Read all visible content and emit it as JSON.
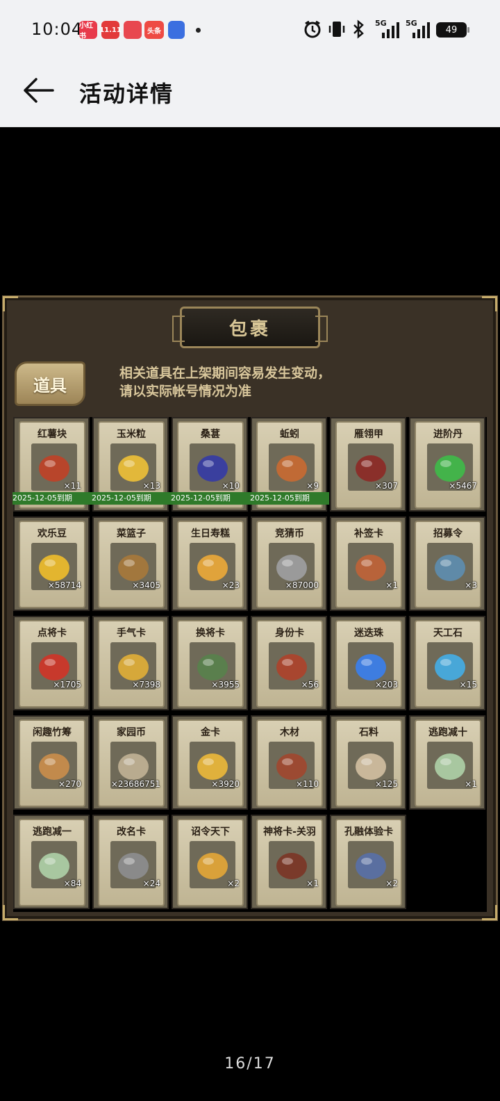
{
  "status_bar": {
    "time": "10:04",
    "notifications": [
      {
        "icon": "xiaohongshu-app-icon",
        "text": "小红书",
        "color": "#e83a4b"
      },
      {
        "icon": "tmall-1111-app-icon",
        "text": "11.11",
        "color": "#e23a3a"
      },
      {
        "icon": "dianping-app-icon",
        "text": "",
        "color": "#e8474f"
      },
      {
        "icon": "toutiao-app-icon",
        "text": "头条",
        "color": "#ee4a43"
      },
      {
        "icon": "browser-app-icon",
        "text": "",
        "color": "#3b6fe0"
      }
    ],
    "signal_1": "5G",
    "signal_2": "5G",
    "battery": "49"
  },
  "app_bar": {
    "title": "活动详情"
  },
  "panel": {
    "title": "包裹",
    "tab": "道具",
    "notice_line1": "相关道具在上架期间容易发生变动，",
    "notice_line2": "请以实际帐号情况为准"
  },
  "items": [
    {
      "name": "红薯块",
      "count": "×11",
      "icon": "sweet-potato-icon",
      "color": "#b8452b",
      "expiry": "2025-12-05到期"
    },
    {
      "name": "玉米粒",
      "count": "×13",
      "icon": "corn-icon",
      "color": "#e2b83a",
      "expiry": "2025-12-05到期"
    },
    {
      "name": "桑葚",
      "count": "×10",
      "icon": "mulberry-icon",
      "color": "#3a3f9e",
      "expiry": "2025-12-05到期"
    },
    {
      "name": "蚯蚓",
      "count": "×9",
      "icon": "earthworm-icon",
      "color": "#c06a35",
      "expiry": "2025-12-05到期"
    },
    {
      "name": "雁翎甲",
      "count": "×307",
      "icon": "armor-icon",
      "color": "#8a2f2a"
    },
    {
      "name": "进阶丹",
      "count": "×5467",
      "icon": "green-pill-icon",
      "color": "#43b34a"
    },
    {
      "name": "欢乐豆",
      "count": "×58714",
      "icon": "gold-beans-icon",
      "color": "#e3b52f"
    },
    {
      "name": "菜篮子",
      "count": "×3405",
      "icon": "vegetable-basket-icon",
      "color": "#a2773d"
    },
    {
      "name": "生日寿糕",
      "count": "×23",
      "icon": "birthday-cake-icon",
      "color": "#e0a33b"
    },
    {
      "name": "竞猜币",
      "count": "×87000",
      "icon": "silver-coin-icon",
      "color": "#9a9a9a"
    },
    {
      "name": "补签卡",
      "count": "×1",
      "icon": "makeup-card-icon",
      "color": "#b8633a"
    },
    {
      "name": "招募令",
      "count": "×3",
      "icon": "recruit-token-icon",
      "color": "#5f8aa8"
    },
    {
      "name": "点将卡",
      "count": "×1705",
      "icon": "general-card-icon",
      "color": "#c7392c"
    },
    {
      "name": "手气卡",
      "count": "×7398",
      "icon": "luck-card-icon",
      "color": "#d6a83a"
    },
    {
      "name": "换将卡",
      "count": "×3955",
      "icon": "swap-card-icon",
      "color": "#5a7f4d"
    },
    {
      "name": "身份卡",
      "count": "×56",
      "icon": "identity-mask-icon",
      "color": "#a8462f"
    },
    {
      "name": "迷迭珠",
      "count": "×203",
      "icon": "blue-orb-icon",
      "color": "#3e7de0"
    },
    {
      "name": "天工石",
      "count": "×15",
      "icon": "crystal-icon",
      "color": "#48a7d8"
    },
    {
      "name": "闲趣竹筹",
      "count": "×270",
      "icon": "bamboo-tally-icon",
      "color": "#c28a4c"
    },
    {
      "name": "家园币",
      "count": "×23686751",
      "icon": "home-coin-icon",
      "color": "#b9ab8f"
    },
    {
      "name": "金卡",
      "count": "×3920",
      "icon": "gold-card-icon",
      "color": "#e0b13c"
    },
    {
      "name": "木材",
      "count": "×110",
      "icon": "wood-icon",
      "color": "#9c4a32"
    },
    {
      "name": "石料",
      "count": "×125",
      "icon": "stone-icon",
      "color": "#c9b79a"
    },
    {
      "name": "逃跑减十",
      "count": "×1",
      "icon": "escape-tag-icon",
      "color": "#a8c7a0"
    },
    {
      "name": "逃跑减一",
      "count": "×84",
      "icon": "escape-tag-icon",
      "color": "#a8c7a0"
    },
    {
      "name": "改名卡",
      "count": "×24",
      "icon": "rename-card-icon",
      "color": "#8a8a8a"
    },
    {
      "name": "诏令天下",
      "count": "×2",
      "icon": "edict-scroll-icon",
      "color": "#d9a13a"
    },
    {
      "name": "神将卡-关羽",
      "count": "×1",
      "icon": "guan-yu-portrait-icon",
      "color": "#7a3a2a"
    },
    {
      "name": "孔融体验卡",
      "count": "×2",
      "icon": "kong-rong-portrait-icon",
      "color": "#5a6fa0"
    }
  ],
  "pager": "16/17"
}
